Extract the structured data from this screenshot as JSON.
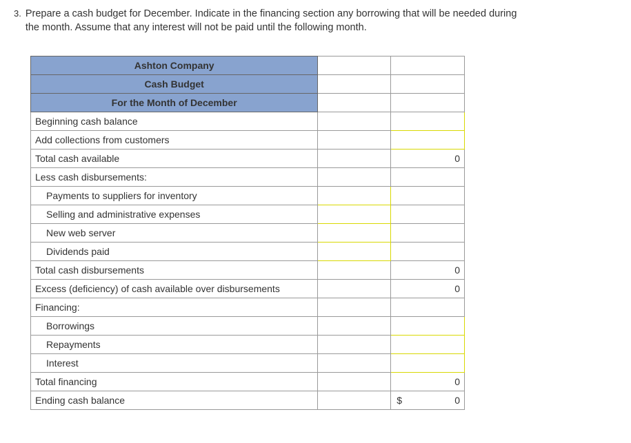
{
  "question": {
    "number": "3.",
    "text": "Prepare a cash budget for December. Indicate in the financing section any borrowing that will be needed during the month. Assume that any interest will not be paid until the following month."
  },
  "header": {
    "company": "Ashton Company",
    "report": "Cash Budget",
    "period": "For the Month of December"
  },
  "rows": {
    "beginning_cash_balance": "Beginning cash balance",
    "add_collections": "Add collections from customers",
    "total_cash_available": "Total cash available",
    "less_disbursements": "Less cash disbursements:",
    "payments_suppliers": "Payments to suppliers for inventory",
    "selling_admin": "Selling and administrative expenses",
    "new_web_server": "New web server",
    "dividends_paid": "Dividends paid",
    "total_disbursements": "Total cash disbursements",
    "excess_deficiency": "Excess (deficiency) of cash available over disbursements",
    "financing": "Financing:",
    "borrowings": "Borrowings",
    "repayments": "Repayments",
    "interest": "Interest",
    "total_financing": "Total financing",
    "ending_cash_balance": "Ending cash balance"
  },
  "values": {
    "total_cash_available": "0",
    "total_disbursements": "0",
    "excess_deficiency": "0",
    "total_financing": "0",
    "ending_cash_currency": "$",
    "ending_cash_balance": "0"
  }
}
